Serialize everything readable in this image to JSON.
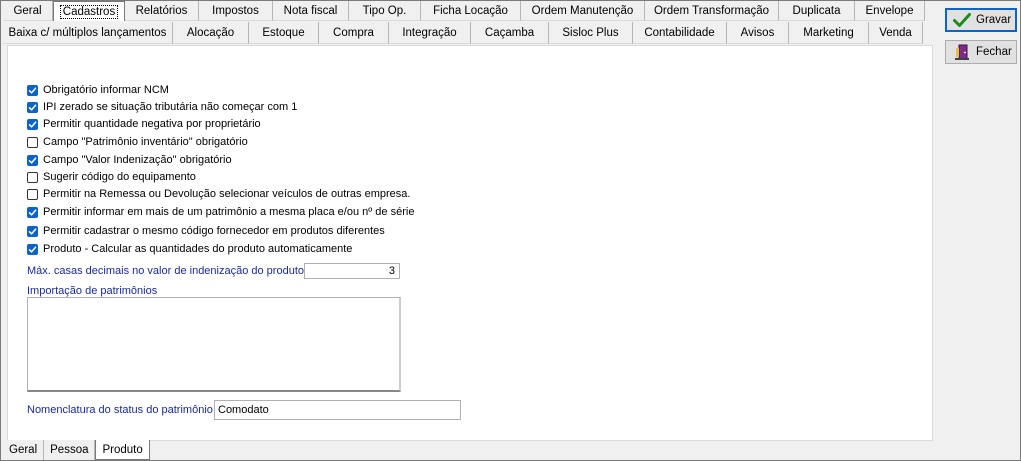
{
  "tabs_row1": [
    {
      "label": "Geral",
      "width": 50
    },
    {
      "label": "Cadastros",
      "width": 72,
      "active": true
    },
    {
      "label": "Relatórios",
      "width": 74
    },
    {
      "label": "Impostos",
      "width": 74
    },
    {
      "label": "Nota fiscal",
      "width": 76
    },
    {
      "label": "Tipo Op.",
      "width": 72
    },
    {
      "label": "Ficha Locação",
      "width": 100
    },
    {
      "label": "Ordem Manutenção",
      "width": 124
    },
    {
      "label": "Ordem Transformação",
      "width": 134
    },
    {
      "label": "Duplicata",
      "width": 76
    },
    {
      "label": "Envelope",
      "width": 70
    }
  ],
  "tabs_row2": [
    {
      "label": "Baixa c/ múltiplos lançamentos",
      "width": 170
    },
    {
      "label": "Alocação",
      "width": 76
    },
    {
      "label": "Estoque",
      "width": 70
    },
    {
      "label": "Compra",
      "width": 70
    },
    {
      "label": "Integração",
      "width": 82
    },
    {
      "label": "Caçamba",
      "width": 78
    },
    {
      "label": "Sisloc Plus",
      "width": 84
    },
    {
      "label": "Contabilidade",
      "width": 94
    },
    {
      "label": "Avisos",
      "width": 62
    },
    {
      "label": "Marketing",
      "width": 80
    },
    {
      "label": "Venda",
      "width": 54
    }
  ],
  "checkboxes": [
    {
      "label": "Obrigatório informar NCM",
      "checked": true
    },
    {
      "label": "IPI zerado se situação tributária não começar com 1",
      "checked": true
    },
    {
      "label": "Permitir quantidade negativa por proprietário",
      "checked": true
    },
    {
      "label": "Campo \"Patrimônio inventário\" obrigatório",
      "checked": false
    },
    {
      "label": "Campo \"Valor Indenização\" obrigatório",
      "checked": true
    },
    {
      "label": "Sugerir código do equipamento",
      "checked": false
    },
    {
      "label": "Permitir na Remessa ou Devolução selecionar veículos de outras empresa.",
      "checked": false
    },
    {
      "label": "Permitir informar em mais de um patrimônio a mesma placa e/ou nº de série",
      "checked": true
    },
    {
      "label": "Permitir cadastrar o mesmo código fornecedor em produtos diferentes",
      "checked": true
    },
    {
      "label": "Produto - Calcular as quantidades do produto automaticamente",
      "checked": true
    }
  ],
  "decimals": {
    "label": "Máx. casas decimais no valor de indenização do produto",
    "value": "3"
  },
  "import": {
    "label": "Importação de patrimônios",
    "value": ""
  },
  "status_nomenclature": {
    "label": "Nomenclatura do status do patrimônio",
    "value": "Comodato"
  },
  "buttons": {
    "save": "Gravar",
    "close": "Fechar"
  },
  "bottom_tabs": [
    {
      "label": "Geral"
    },
    {
      "label": "Pessoa"
    },
    {
      "label": "Produto",
      "active": true
    }
  ],
  "colors": {
    "accent": "#0a64c8",
    "label_blue": "#1a2a9a",
    "save_icon": "#1e8a1e"
  }
}
